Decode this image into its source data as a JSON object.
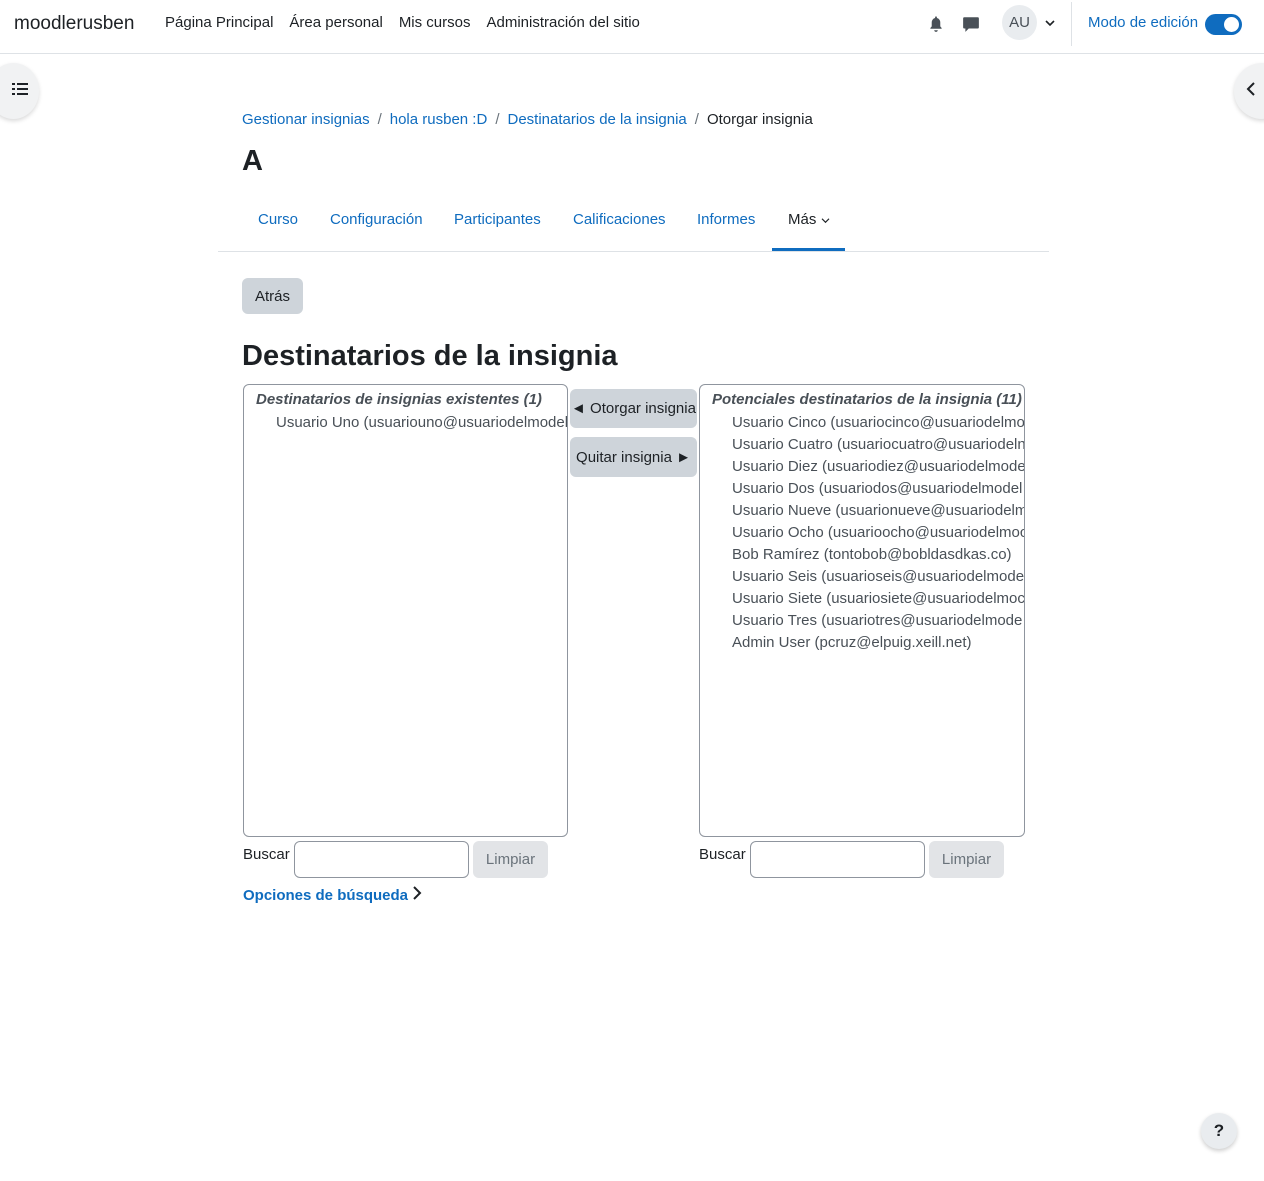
{
  "navbar": {
    "brand": "moodlerusben",
    "links": [
      "Página Principal",
      "Área personal",
      "Mis cursos",
      "Administración del sitio"
    ],
    "avatar_initials": "AU",
    "edit_mode_label": "Modo de edición",
    "edit_mode_on": true
  },
  "breadcrumb": {
    "items": [
      "Gestionar insignias",
      "hola rusben :D",
      "Destinatarios de la insignia"
    ],
    "current": "Otorgar insignia"
  },
  "course_title": "A",
  "secondary_nav": {
    "tabs": [
      "Curso",
      "Configuración",
      "Participantes",
      "Calificaciones",
      "Informes"
    ],
    "more_label": "Más",
    "active": "Más"
  },
  "back_button": "Atrás",
  "page_heading": "Destinatarios de la insignia",
  "existing": {
    "label": "Destinatarios de insignias existentes (1)",
    "users": [
      "Usuario Uno (usuariouno@usuariodelmodel"
    ]
  },
  "potential": {
    "label": "Potenciales destinatarios de la insignia (11)",
    "users": [
      "Usuario Cinco (usuariocinco@usuariodelmo",
      "Usuario Cuatro (usuariocuatro@usuariodeln",
      "Usuario Diez (usuariodiez@usuariodelmode",
      "Usuario Dos (usuariodos@usuariodelmodel",
      "Usuario Nueve (usuarionueve@usuariodelm",
      "Usuario Ocho (usuarioocho@usuariodelmoc",
      "Bob Ramírez (tontobob@bobldasdkas.co)",
      "Usuario Seis (usuarioseis@usuariodelmode",
      "Usuario Siete (usuariosiete@usuariodelmoc",
      "Usuario Tres (usuariotres@usuariodelmode",
      "Admin User (pcruz@elpuig.xeill.net)"
    ]
  },
  "actions": {
    "add": "◄ Otorgar insignia",
    "remove": "Quitar insignia ►"
  },
  "search": {
    "label": "Buscar",
    "clear": "Limpiar",
    "left_value": "",
    "right_value": ""
  },
  "search_options": "Opciones de búsqueda",
  "help_label": "?"
}
